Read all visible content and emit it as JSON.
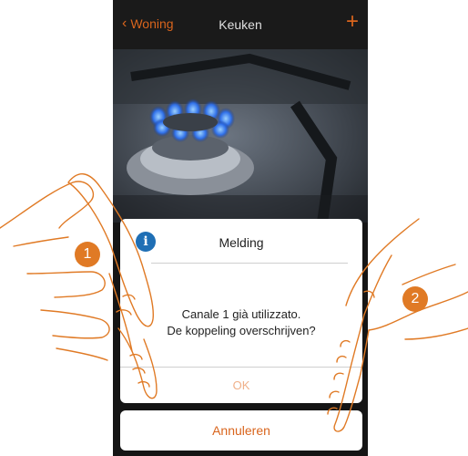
{
  "header": {
    "back_label": "Woning",
    "title": "Keuken",
    "add_icon": "plus-icon"
  },
  "dialog": {
    "title": "Melding",
    "icon": "info-icon",
    "icon_glyph": "i",
    "message_line1": "Canale 1 già utilizzato.",
    "message_line2": "De koppeling overschrijven?",
    "ok_label": "OK",
    "cancel_label": "Annuleren"
  },
  "steps": {
    "step1": "1",
    "step2": "2"
  },
  "colors": {
    "accent": "#d9651d",
    "info": "#1f6fb5",
    "badge": "#e07a25"
  }
}
